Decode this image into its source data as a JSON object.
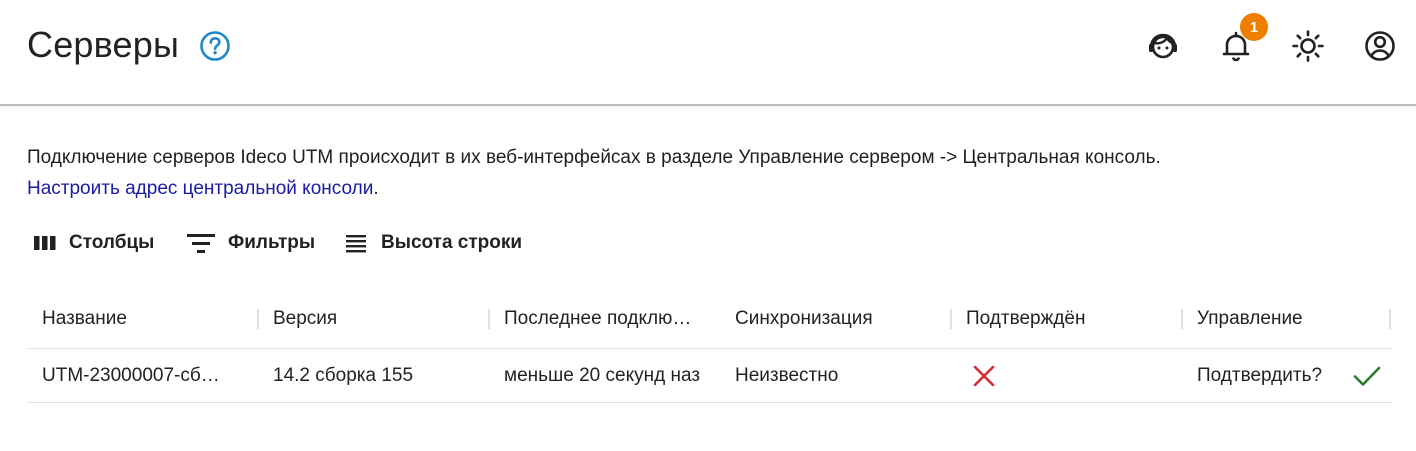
{
  "header": {
    "title": "Серверы",
    "notification_count": "1",
    "icons": [
      "help-icon",
      "support-agent-icon",
      "bell-icon",
      "theme-sun-icon",
      "account-icon"
    ]
  },
  "info": {
    "text": "Подключение серверов Ideco UTM происходит в их веб-интерфейсах в разделе Управление сервером -> Центральная консоль.",
    "link": "Настроить адрес центральной консоли",
    "link_suffix": "."
  },
  "toolbar": {
    "columns_label": "Столбцы",
    "filters_label": "Фильтры",
    "row_height_label": "Высота строки"
  },
  "table": {
    "columns": [
      "Название",
      "Версия",
      "Последнее подклю…",
      "Синхронизация",
      "Подтверждён",
      "Управление"
    ],
    "rows": [
      {
        "name": "UTM-23000007-сб…",
        "version": "14.2 сборка 155",
        "last_connection": "меньше 20 секунд наз",
        "sync": "Неизвестно",
        "confirmed": "no",
        "action": "Подтвердить?"
      }
    ]
  },
  "colors": {
    "accent_blue": "#1e88c8",
    "badge_orange": "#ef7d00",
    "link_blue": "#1a1aa6",
    "cross_red": "#d32f2f",
    "check_green": "#2e7d32"
  }
}
